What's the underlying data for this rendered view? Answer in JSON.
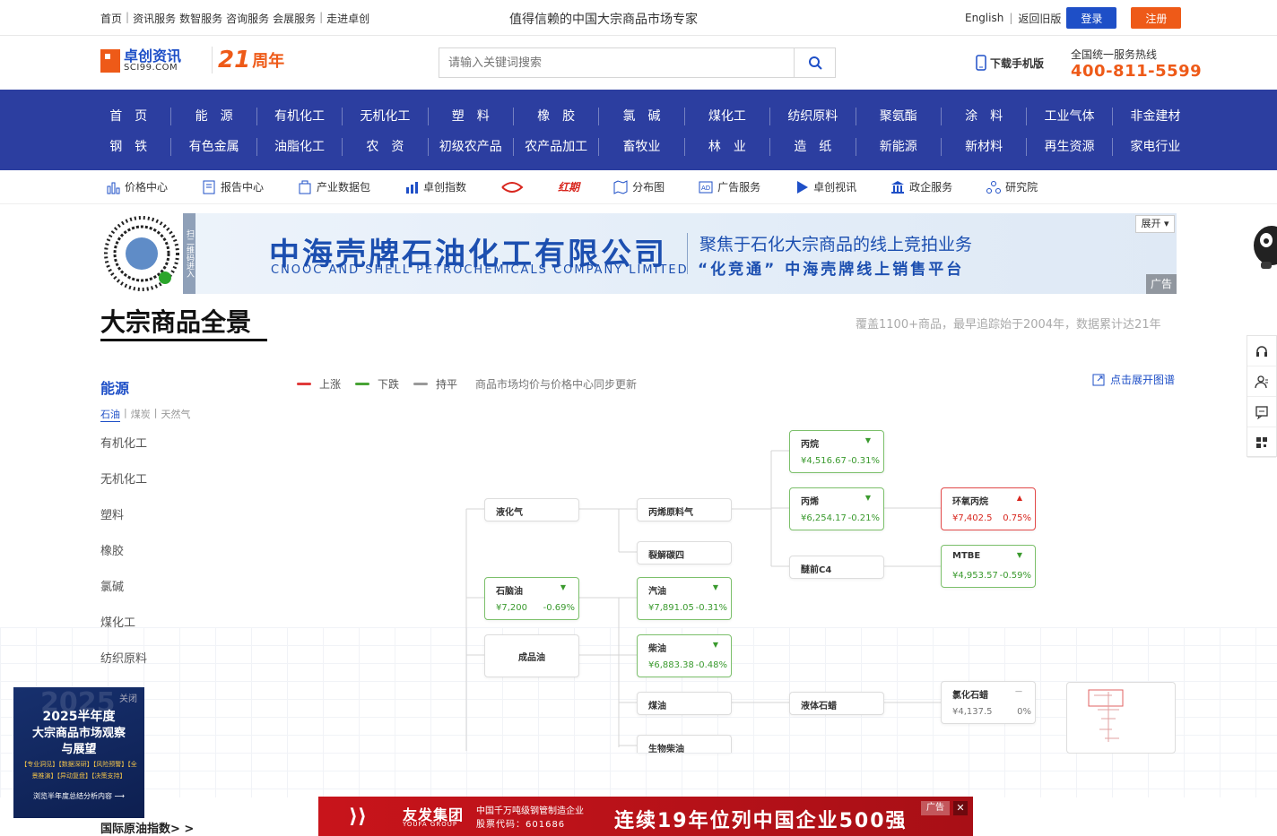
{
  "topbar": {
    "links": [
      "首页",
      "资讯服务",
      "数智服务",
      "咨询服务",
      "会展服务",
      "走进卓创"
    ],
    "slogan": "值得信赖的中国大宗商品市场专家",
    "english": "English",
    "old_version": "返回旧版",
    "login": "登录",
    "register": "注册"
  },
  "header": {
    "logo_cn": "卓创资讯",
    "logo_en": "SCI99.COM",
    "anniversary_num": "21",
    "anniversary_text": "周年",
    "search_placeholder": "请输入关键词搜索",
    "mobile": "下载手机版",
    "hotline_title": "全国统一服务热线",
    "hotline_number": "400-811-5599"
  },
  "nav": {
    "row1": [
      "首　页",
      "能　源",
      "有机化工",
      "无机化工",
      "塑　料",
      "橡　胶",
      "氯　碱",
      "煤化工",
      "纺织原料",
      "聚氨酯",
      "涂　料",
      "工业气体",
      "非金建材"
    ],
    "row2": [
      "钢　铁",
      "有色金属",
      "油脂化工",
      "农　资",
      "初级农产品",
      "农产品加工",
      "畜牧业",
      "林　业",
      "造　纸",
      "新能源",
      "新材料",
      "再生资源",
      "家电行业"
    ]
  },
  "tools": [
    {
      "label": "价格中心",
      "icon": "bar-chart-icon"
    },
    {
      "label": "报告中心",
      "icon": "report-icon"
    },
    {
      "label": "产业数据包",
      "icon": "data-package-icon"
    },
    {
      "label": "卓创指数",
      "icon": "index-icon"
    },
    {
      "label": "",
      "icon": "red-logo-icon"
    },
    {
      "label": "红期",
      "icon": "hongqi-logo-icon"
    },
    {
      "label": "分布图",
      "icon": "map-icon"
    },
    {
      "label": "广告服务",
      "icon": "ad-icon"
    },
    {
      "label": "卓创视讯",
      "icon": "video-icon"
    },
    {
      "label": "政企服务",
      "icon": "government-icon"
    },
    {
      "label": "研究院",
      "icon": "institute-icon"
    }
  ],
  "banner": {
    "qr_side": "扫二维码进入",
    "company_cn": "中海壳牌石油化工有限公司",
    "company_en": "CNOOC AND SHELL PETROCHEMICALS COMPANY LIMITED",
    "line1": "聚焦于石化大宗商品的线上竞拍业务",
    "line2": "“化竞通”  中海壳牌线上销售平台",
    "expand": "展开",
    "ad_tag": "广告"
  },
  "section": {
    "title": "大宗商品全景",
    "note": "覆盖1100+商品，最早追踪始于2004年，数据累计达21年"
  },
  "categories": {
    "active": "能源",
    "subs": [
      "石油",
      "煤炭",
      "天然气"
    ],
    "active_sub": "石油",
    "list": [
      "有机化工",
      "无机化工",
      "塑料",
      "橡胶",
      "氯碱",
      "煤化工",
      "纺织原料"
    ]
  },
  "legend": {
    "up": "上涨",
    "down": "下跌",
    "flat": "持平",
    "note": "商品市场均价与价格中心同步更新",
    "expand_graph": "点击展开图谱"
  },
  "colors": {
    "up": "#e03a3a",
    "down": "#48a335",
    "flat": "#999999",
    "brand_blue": "#2c3ea0",
    "brand_orange": "#ee5a18"
  },
  "graph": {
    "nodes": {
      "lpg": {
        "name": "液化气"
      },
      "naphtha": {
        "name": "石脑油",
        "price": "¥7,200",
        "change": "-0.69%"
      },
      "refined": {
        "name": "成品油"
      },
      "propylene_gas": {
        "name": "丙烯原料气"
      },
      "c4": {
        "name": "裂解碳四"
      },
      "gasoline": {
        "name": "汽油",
        "price": "¥7,891.05",
        "change": "-0.31%"
      },
      "diesel": {
        "name": "柴油",
        "price": "¥6,883.38",
        "change": "-0.48%"
      },
      "kerosene": {
        "name": "煤油"
      },
      "biodiesel": {
        "name": "生物柴油"
      },
      "propane": {
        "name": "丙烷",
        "price": "¥4,516.67",
        "change": "-0.31%"
      },
      "propylene": {
        "name": "丙烯",
        "price": "¥6,254.17",
        "change": "-0.21%"
      },
      "ether_c4": {
        "name": "醚前C4"
      },
      "liquid_wax": {
        "name": "液体石蜡"
      },
      "epoxy": {
        "name": "环氧丙烷",
        "price": "¥7,402.5",
        "change": "0.75%"
      },
      "mtbe": {
        "name": "MTBE",
        "price": "¥4,953.57",
        "change": "-0.59%"
      },
      "chlorinated": {
        "name": "氯化石蜡",
        "price": "¥4,137.5",
        "change": "0%"
      }
    }
  },
  "promo": {
    "close": "关闭",
    "year": "2025",
    "line1": "2025半年度",
    "line2": "大宗商品市场观察",
    "line3": "与展望",
    "tags": "【专业洞见】【数据深研】【风险预警】【全景推演】【异动复盘】【决策支持】",
    "cta": "浏览半年度总结分析内容 ⟶"
  },
  "bottom_link": "国际原油指数> >",
  "bottom_ad": {
    "brand": "友发集团",
    "brand_en": "YOUFA GROUP",
    "info1": "中国千万吨级钢管制造企业",
    "info2": "股票代码：601686",
    "slogan": "连续19年位列中国企业500强",
    "ad_tag": "广告",
    "close": "✕"
  }
}
